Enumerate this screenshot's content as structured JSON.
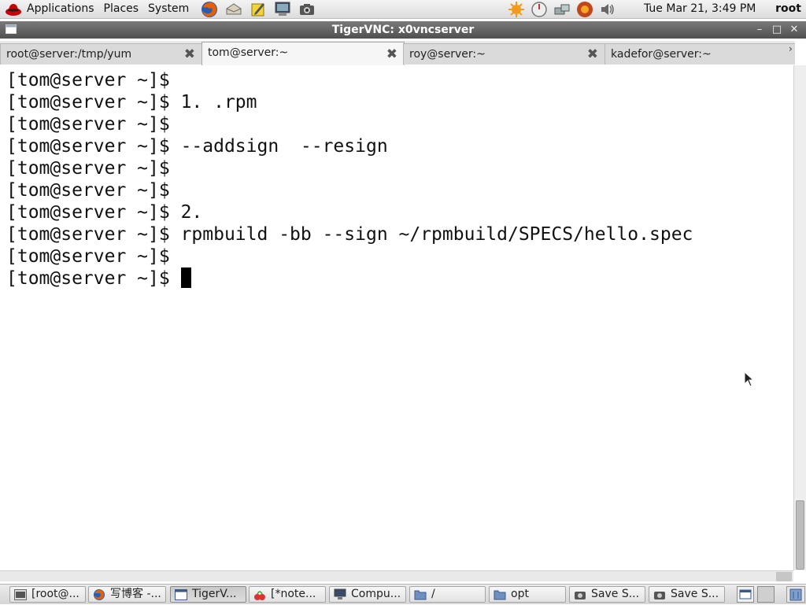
{
  "top_panel": {
    "menus": [
      "Applications",
      "Places",
      "System"
    ],
    "clock": "Tue Mar 21,  3:49 PM",
    "user": "root"
  },
  "window": {
    "title": "TigerVNC: x0vncserver"
  },
  "tabs": [
    {
      "label": "root@server:/tmp/yum",
      "active": false
    },
    {
      "label": "tom@server:~",
      "active": true
    },
    {
      "label": "roy@server:~",
      "active": false
    },
    {
      "label": "kadefor@server:~",
      "active": false
    }
  ],
  "terminal": {
    "prompt": "[tom@server ~]$",
    "lines": [
      "",
      " 1. .rpm",
      "",
      " --addsign  --resign",
      "",
      "",
      " 2.",
      " rpmbuild -bb --sign ~/rpmbuild/SPECS/hello.spec",
      "",
      " "
    ]
  },
  "taskbar": {
    "tasks": [
      {
        "label": "[root@...",
        "icon": "terminal-icon"
      },
      {
        "label": "写博客 -...",
        "icon": "firefox-icon"
      },
      {
        "label": "TigerV...",
        "icon": "window-icon",
        "active": true
      },
      {
        "label": "[*note...",
        "icon": "notes-icon"
      },
      {
        "label": "Compu...",
        "icon": "computer-icon"
      },
      {
        "label": "/",
        "icon": "folder-icon"
      },
      {
        "label": "opt",
        "icon": "folder-icon"
      },
      {
        "label": "Save S...",
        "icon": "camera-icon"
      },
      {
        "label": "Save S...",
        "icon": "camera-icon"
      }
    ]
  }
}
